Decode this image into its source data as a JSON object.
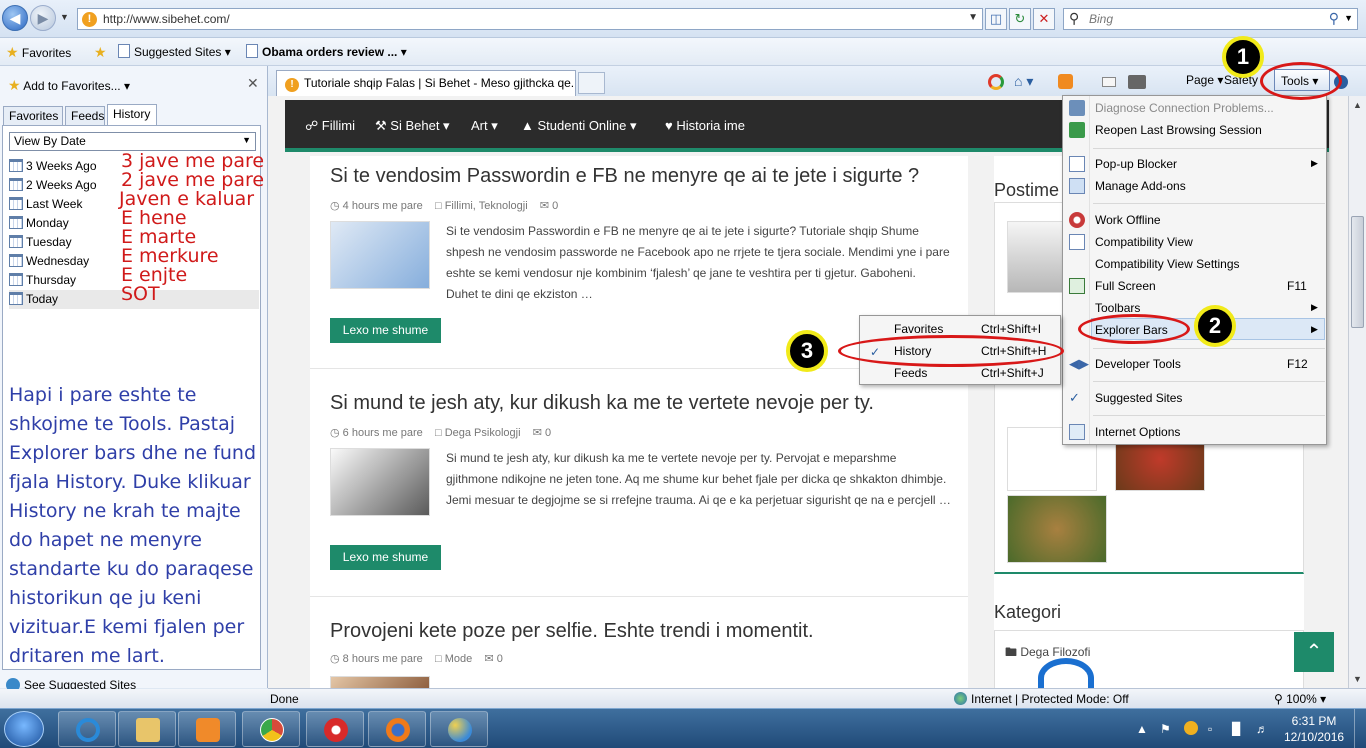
{
  "address_bar": {
    "url": "http://www.sibehet.com/",
    "search_placeholder": "Bing"
  },
  "favorites_bar": {
    "favorites_label": "Favorites",
    "suggested_sites": "Suggested Sites",
    "obama_link": "Obama orders review ..."
  },
  "side_panel": {
    "add_to_favorites": "Add to Favorites...",
    "tabs": [
      "Favorites",
      "Feeds",
      "History"
    ],
    "view_by": "View By Date",
    "history": [
      {
        "label": "3 Weeks Ago",
        "note": "3 jave me pare"
      },
      {
        "label": "2 Weeks Ago",
        "note": "2 jave me pare"
      },
      {
        "label": "Last Week",
        "note": "Javen e kaluar"
      },
      {
        "label": "Monday",
        "note": "E hene"
      },
      {
        "label": "Tuesday",
        "note": "E marte"
      },
      {
        "label": "Wednesday",
        "note": "E merkure"
      },
      {
        "label": "Thursday",
        "note": "E enjte"
      },
      {
        "label": "Today",
        "note": "SOT"
      }
    ],
    "instruction": "Hapi i pare eshte te shkojme te Tools. Pastaj Explorer bars dhe ne fund fjala History. Duke klikuar History ne krah te majte do hapet ne menyre standarte ku do paraqese historikun qe ju keni vizituar.E kemi fjalen per dritaren me lart.",
    "see_suggested": "See Suggested Sites"
  },
  "tab_bar": {
    "tab_title": "Tutoriale shqip Falas | Si Behet - Meso gjithcka qe...",
    "page": "Page",
    "safety": "Safety",
    "tools": "Tools"
  },
  "site": {
    "nav": [
      "Fillimi",
      "Si Behet",
      "Art",
      "Studenti Online",
      "Historia ime"
    ],
    "posts": [
      {
        "title": "Si te vendosim Passwordin e FB ne menyre qe ai te jete i sigurte ?",
        "time": "4 hours me pare",
        "cats": "Fillimi, Teknologji",
        "comments": "0",
        "excerpt": "Si te vendosim Passwordin e FB ne menyre qe ai te jete i sigurte? Tutoriale shqip Shume shpesh ne vendosim passworde ne Facebook apo ne rrjete te tjera sociale. Mendimi yne i pare eshte se kemi vendosur nje kombinim ‘fjalesh’ qe jane te veshtira per ti gjetur. Gaboheni. Duhet te dini qe ekziston …",
        "button": "Lexo me shume"
      },
      {
        "title": "Si mund te jesh aty, kur dikush ka me te vertete nevoje per ty.",
        "time": "6 hours me pare",
        "cats": "Dega Psikologji",
        "comments": "0",
        "excerpt": "Si mund te jesh aty, kur dikush ka me te vertete nevoje per ty. Pervojat e meparshme gjithmone ndikojne ne jeten tone. Aq me shume kur behet fjale per dicka qe shkakton dhimbje. Jemi mesuar te degjojme se si rrefejne trauma. Ai qe e ka perjetuar sigurisht qe na e percjell …",
        "button": "Lexo me shume"
      },
      {
        "title": "Provojeni kete poze per selfie. Eshte trendi i momentit.",
        "time": "8 hours me pare",
        "cats": "Mode",
        "comments": "0"
      }
    ],
    "widget_title": "Postime",
    "kategori_title": "Kategori",
    "categories": [
      "Dega Filozofi"
    ]
  },
  "tools_menu": {
    "items": [
      {
        "label": "Diagnose Connection Problems...",
        "key": ""
      },
      {
        "label": "Reopen Last Browsing Session",
        "key": ""
      },
      {
        "label": "Pop-up Blocker",
        "key": ""
      },
      {
        "label": "Manage Add-ons",
        "key": ""
      },
      {
        "label": "Work Offline",
        "key": ""
      },
      {
        "label": "Compatibility View",
        "key": ""
      },
      {
        "label": "Compatibility View Settings",
        "key": ""
      },
      {
        "label": "Full Screen",
        "key": "F11"
      },
      {
        "label": "Toolbars",
        "key": ""
      },
      {
        "label": "Explorer Bars",
        "key": ""
      },
      {
        "label": "Developer Tools",
        "key": "F12"
      },
      {
        "label": "Suggested Sites",
        "key": ""
      },
      {
        "label": "Internet Options",
        "key": ""
      }
    ]
  },
  "explorer_submenu": {
    "items": [
      {
        "label": "Favorites",
        "key": "Ctrl+Shift+I"
      },
      {
        "label": "History",
        "key": "Ctrl+Shift+H"
      },
      {
        "label": "Feeds",
        "key": "Ctrl+Shift+J"
      }
    ]
  },
  "annotations": {
    "step1": "1",
    "step2": "2",
    "step3": "3"
  },
  "status_bar": {
    "status": "Done",
    "zone": "Internet | Protected Mode: Off",
    "zoom": "100%"
  },
  "taskbar": {
    "time": "6:31 PM",
    "date": "12/10/2016"
  },
  "colors": {
    "accent_green": "#1e8a6a",
    "annotation_red": "#d01a1a",
    "annotation_blue": "#2f3fa8",
    "callout_yellow": "#f1ea1a"
  }
}
